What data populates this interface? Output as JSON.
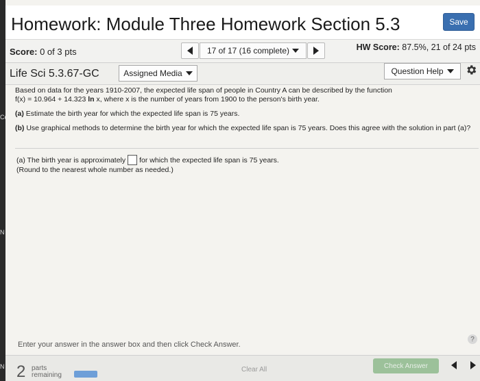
{
  "header": {
    "title": "Homework: Module Three Homework Section 5.3",
    "save_label": "Save"
  },
  "scorebar": {
    "score_label": "Score:",
    "score_value": "0 of 3 pts",
    "question_selector": "17 of 17 (16 complete)",
    "hw_score_label": "HW Score:",
    "hw_score_value": "87.5%, 21 of 24 pts"
  },
  "problem": {
    "name": "Life Sci 5.3.67-GC",
    "assigned_media_label": "Assigned Media",
    "question_help_label": "Question Help"
  },
  "question": {
    "intro_line1": "Based on data for the years 1910-2007, the expected life span of people in Country A can be described by the function",
    "intro_line2_a": "f(x) = 10.964 + 14.323 ",
    "intro_line2_ln": "ln",
    "intro_line2_b": " x, where x is the number of years from 1900 to the person's birth year.",
    "part_a_label": "(a)",
    "part_a_text": " Estimate the birth year for which the expected life span is 75 years.",
    "part_b_label": "(b)",
    "part_b_text": " Use graphical methods to determine the birth year for which the expected life span is 75 years. Does this agree with the solution in part (a)?"
  },
  "answer": {
    "prefix": "(a) The birth year is approximately",
    "suffix": "for which the expected life span is 75 years.",
    "note": "(Round to the nearest whole number as needed.)",
    "input_value": ""
  },
  "instruction": "Enter your answer in the answer box and then click Check Answer.",
  "footer": {
    "parts_count": "2",
    "parts_word": "parts",
    "remaining_word": "remaining",
    "parts_progress": 0.5,
    "clear_all_label": "Clear All",
    "check_answer_label": "Check Answer"
  },
  "colors": {
    "save_button": "#3a6fb0",
    "check_answer_button": "#9cc19a",
    "progress_bar": "#6e9fd8"
  },
  "edge_letters": [
    "Co",
    "N",
    "N"
  ],
  "help_glyph": "?"
}
